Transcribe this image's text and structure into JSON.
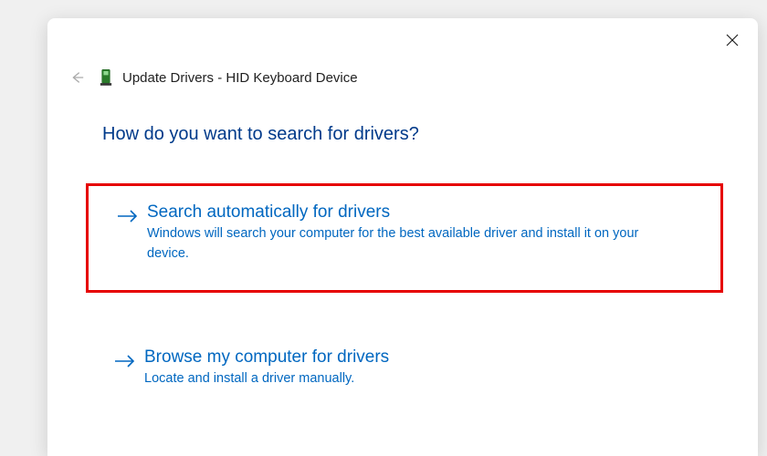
{
  "header": {
    "title": "Update Drivers - HID Keyboard Device"
  },
  "question": "How do you want to search for drivers?",
  "options": [
    {
      "title": "Search automatically for drivers",
      "desc": "Windows will search your computer for the best available driver and install it on your device."
    },
    {
      "title": "Browse my computer for drivers",
      "desc": "Locate and install a driver manually."
    }
  ]
}
